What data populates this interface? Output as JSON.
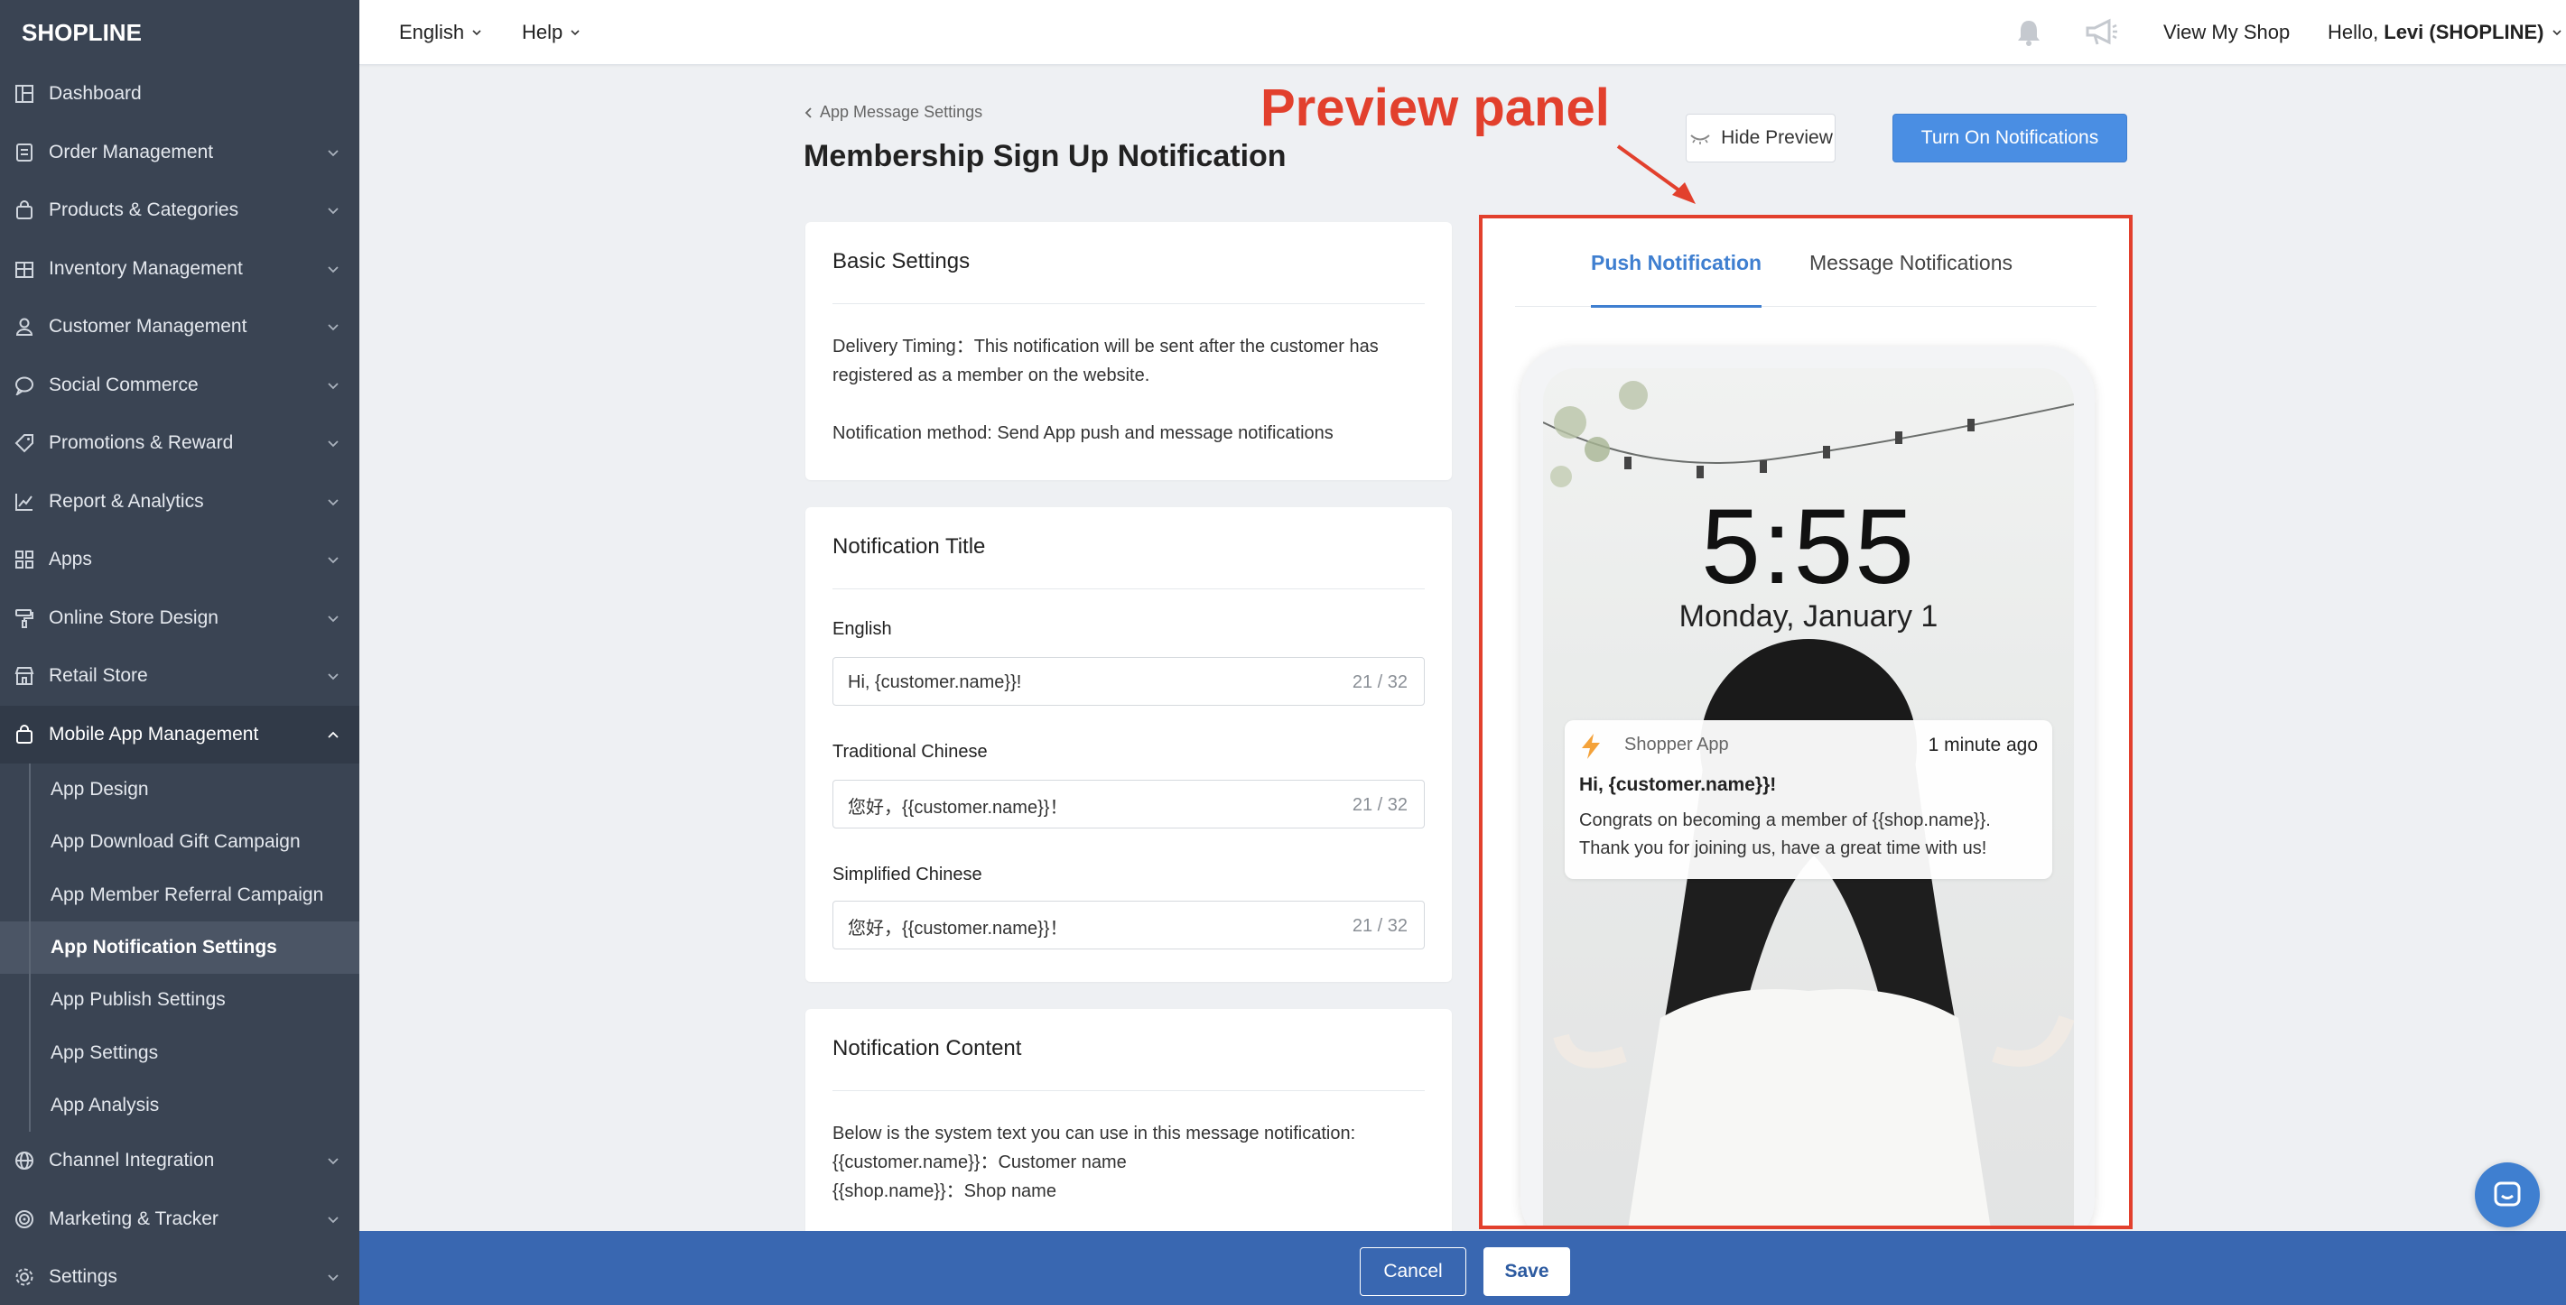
{
  "brand": {
    "logo": "SHOPLINE"
  },
  "sidebar": {
    "items": [
      {
        "label": "Dashboard",
        "icon": "dashboard-icon"
      },
      {
        "label": "Order Management",
        "icon": "order-icon"
      },
      {
        "label": "Products & Categories",
        "icon": "bag-icon"
      },
      {
        "label": "Inventory Management",
        "icon": "inventory-icon"
      },
      {
        "label": "Customer Management",
        "icon": "user-icon"
      },
      {
        "label": "Social Commerce",
        "icon": "chat-bubble-icon"
      },
      {
        "label": "Promotions & Reward",
        "icon": "tag-icon"
      },
      {
        "label": "Report & Analytics",
        "icon": "chart-icon"
      },
      {
        "label": "Apps",
        "icon": "apps-icon"
      },
      {
        "label": "Online Store Design",
        "icon": "paint-roller-icon"
      },
      {
        "label": "Retail Store",
        "icon": "store-icon"
      },
      {
        "label": "Mobile App Management",
        "icon": "mobile-bag-icon"
      }
    ],
    "subitems": [
      {
        "label": "App Design"
      },
      {
        "label": "App Download Gift Campaign"
      },
      {
        "label": "App Member Referral Campaign"
      },
      {
        "label": "App Notification Settings"
      },
      {
        "label": "App Publish Settings"
      },
      {
        "label": "App Settings"
      },
      {
        "label": "App Analysis"
      }
    ],
    "bottom_items": [
      {
        "label": "Channel Integration",
        "icon": "globe-icon"
      },
      {
        "label": "Marketing & Tracker",
        "icon": "target-icon"
      },
      {
        "label": "Settings",
        "icon": "gear-icon"
      }
    ]
  },
  "topbar": {
    "language": "English",
    "help": "Help",
    "view_shop": "View My Shop",
    "hello": "Hello,",
    "user": "Levi (SHOPLINE)"
  },
  "header": {
    "breadcrumb": "App Message Settings",
    "title": "Membership Sign Up Notification",
    "hide_preview": "Hide Preview",
    "turn_on": "Turn On Notifications"
  },
  "annotation": {
    "text": "Preview panel"
  },
  "basic_settings": {
    "title": "Basic Settings",
    "delivery": "Delivery Timing：This notification will be sent after the customer has registered as a member on the website.",
    "method": "Notification method: Send App push and message notifications"
  },
  "notification_title": {
    "title": "Notification Title",
    "fields": [
      {
        "label": "English",
        "value": "Hi, {customer.name}}!",
        "count": "21 / 32"
      },
      {
        "label": "Traditional Chinese",
        "value": "您好，{{customer.name}}！",
        "count": "21 / 32"
      },
      {
        "label": "Simplified Chinese",
        "value": "您好，{{customer.name}}！",
        "count": "21 / 32"
      }
    ]
  },
  "notification_content": {
    "title": "Notification Content",
    "intro": "Below is the system text you can use in this message notification:",
    "var1": "{{customer.name}}：Customer name",
    "var2": "{{shop.name}}：Shop name"
  },
  "preview": {
    "tabs": [
      "Push Notification",
      "Message Notifications"
    ],
    "time": "5:55",
    "date": "Monday, January 1",
    "notif": {
      "app_name": "Shopper App",
      "ago": "1 minute ago",
      "title": "Hi, {customer.name}}!",
      "body": "Congrats on becoming a member of {{shop.name}}. Thank you for joining us, have a great time with us!"
    }
  },
  "footer": {
    "cancel": "Cancel",
    "save": "Save"
  },
  "colors": {
    "sidebar_bg": "#3a4453",
    "primary": "#4a8ee3",
    "annotation": "#e2402d",
    "footer_bg": "#3967b1"
  }
}
